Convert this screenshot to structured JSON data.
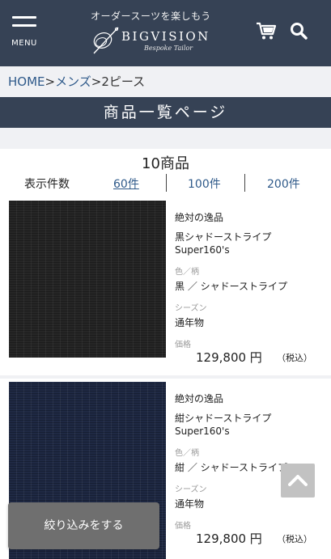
{
  "header": {
    "menu_label": "MENU",
    "tagline": "オーダースーツを楽しもう",
    "logo_text": "BIGVISION",
    "logo_sub": "Bespoke Tailor"
  },
  "breadcrumb": {
    "home": "HOME",
    "sep1": ">",
    "mens": "メンズ",
    "sep2": ">",
    "current": "2ピース"
  },
  "page_title": "商品一覧ページ",
  "results": {
    "count": "10商品",
    "per_page_label": "表示件数",
    "options": [
      "60件",
      "100件",
      "200件"
    ],
    "selected": "60件"
  },
  "products": [
    {
      "brand": "絶対の逸品",
      "name_line1": "黒シャドーストライプ",
      "name_line2": "Super160's",
      "color_label": "色／柄",
      "color_value": "黒 ／ シャドーストライプ",
      "season_label": "シーズン",
      "season_value": "通年物",
      "price_label": "価格",
      "price": "129,800 円",
      "tax": "（税込）"
    },
    {
      "brand": "絶対の逸品",
      "name_line1": "紺シャドーストライプ",
      "name_line2": "Super160's",
      "color_label": "色／柄",
      "color_value": "紺 ／ シャドーストライプ",
      "season_label": "シーズン",
      "season_value": "通年物",
      "price_label": "価格",
      "price": "129,800 円",
      "tax": "（税込）"
    }
  ],
  "filter_button": "絞り込みをする",
  "icons": {
    "menu": "hamburger-icon",
    "cart": "cart-icon",
    "search": "search-icon",
    "back_to_top": "chevron-up-icon"
  }
}
